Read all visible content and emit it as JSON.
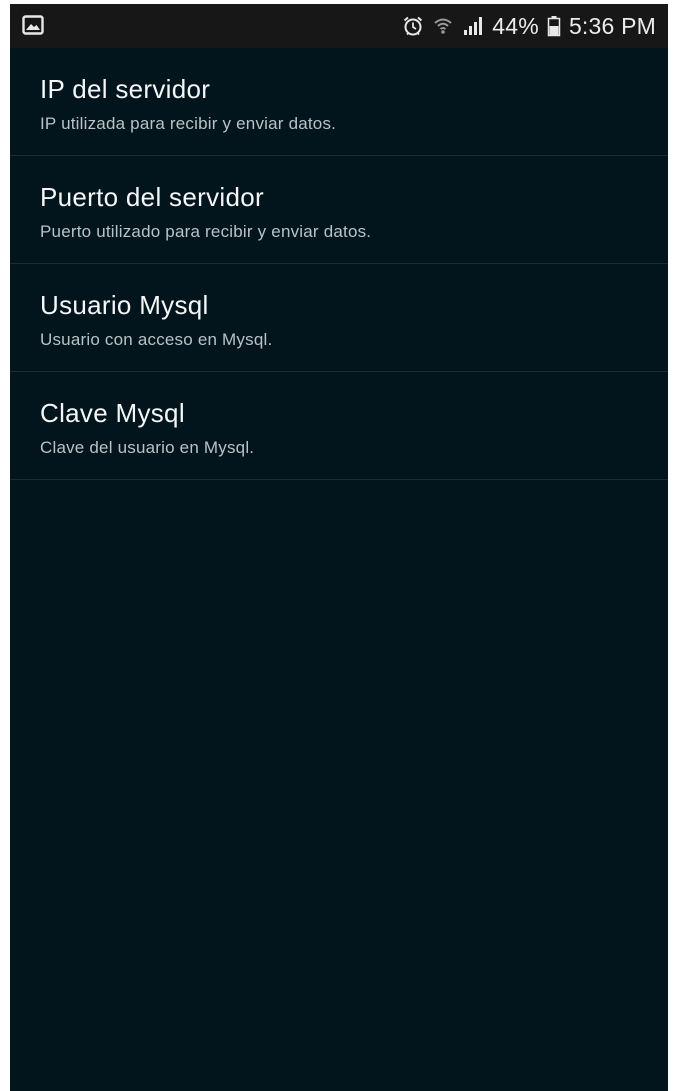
{
  "status_bar": {
    "left_icon": "gallery-notification-icon",
    "icons": [
      "alarm-icon",
      "wifi-icon",
      "signal-icon"
    ],
    "battery_percent": "44%",
    "battery_icon": "battery-icon",
    "time": "5:36 PM"
  },
  "settings": {
    "items": [
      {
        "title": "IP del servidor",
        "summary": "IP utilizada para recibir y enviar datos."
      },
      {
        "title": "Puerto del servidor",
        "summary": "Puerto utilizado para recibir y enviar datos."
      },
      {
        "title": "Usuario Mysql",
        "summary": "Usuario con acceso en Mysql."
      },
      {
        "title": "Clave Mysql",
        "summary": "Clave del usuario en Mysql."
      }
    ]
  },
  "colors": {
    "background": "#02141c",
    "status_bar": "#171717",
    "divider": "#1d2c33",
    "title_text": "#f4f6f7",
    "summary_text": "#b9c2c6"
  }
}
